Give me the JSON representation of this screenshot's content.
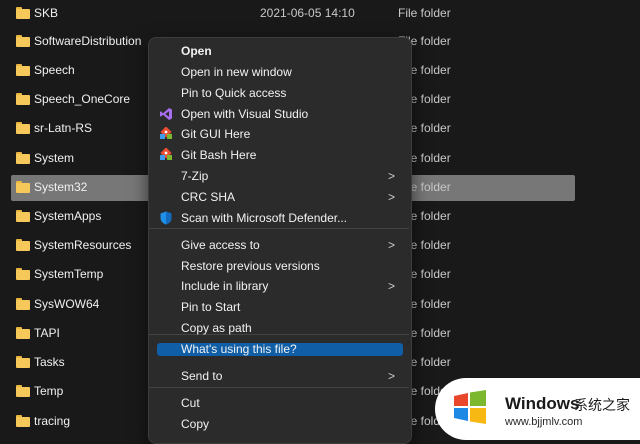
{
  "files": [
    {
      "name": "SKB",
      "date": "2021-06-05 14:10",
      "type": "File folder"
    },
    {
      "name": "SoftwareDistribution",
      "date": "",
      "type": "File folder"
    },
    {
      "name": "Speech",
      "date": "",
      "type": "File folder"
    },
    {
      "name": "Speech_OneCore",
      "date": "",
      "type": "File folder"
    },
    {
      "name": "sr-Latn-RS",
      "date": "",
      "type": "File folder"
    },
    {
      "name": "System",
      "date": "",
      "type": "File folder"
    },
    {
      "name": "System32",
      "date": "",
      "type": "File folder",
      "selected": true
    },
    {
      "name": "SystemApps",
      "date": "",
      "type": "File folder"
    },
    {
      "name": "SystemResources",
      "date": "",
      "type": "File folder"
    },
    {
      "name": "SystemTemp",
      "date": "",
      "type": "File folder"
    },
    {
      "name": "SysWOW64",
      "date": "",
      "type": "File folder"
    },
    {
      "name": "TAPI",
      "date": "",
      "type": "File folder"
    },
    {
      "name": "Tasks",
      "date": "",
      "type": "File folder"
    },
    {
      "name": "Temp",
      "date": "",
      "type": "File folder"
    },
    {
      "name": "tracing",
      "date": "",
      "type": "File folder"
    }
  ],
  "context_menu": {
    "items": [
      {
        "label": "Open",
        "bold": true
      },
      {
        "label": "Open in new window"
      },
      {
        "label": "Pin to Quick access"
      },
      {
        "label": "Open with Visual Studio",
        "icon": "visual-studio-icon"
      },
      {
        "label": "Git GUI Here",
        "icon": "git-icon"
      },
      {
        "label": "Git Bash Here",
        "icon": "git-icon"
      },
      {
        "label": "7-Zip",
        "submenu": true
      },
      {
        "label": "CRC SHA",
        "submenu": true
      },
      {
        "label": "Scan with Microsoft Defender...",
        "icon": "defender-shield-icon"
      },
      {
        "label": "Give access to",
        "submenu": true
      },
      {
        "label": "Restore previous versions"
      },
      {
        "label": "Include in library",
        "submenu": true
      },
      {
        "label": "Pin to Start"
      },
      {
        "label": "Copy as path"
      },
      {
        "label": "What's using this file?",
        "highlighted": true
      },
      {
        "label": "Send to",
        "submenu": true
      },
      {
        "label": "Cut"
      },
      {
        "label": "Copy"
      }
    ],
    "submenu_arrow": ">"
  },
  "watermark": {
    "title": "Windows",
    "subtitle": "系统之家",
    "url": "www.bjjmlv.com"
  },
  "colors": {
    "background": "#191919",
    "menu_background": "#2b2b2b",
    "highlight": "#0f5ea6",
    "selection": "#777777",
    "folder": "#f6c85a"
  }
}
